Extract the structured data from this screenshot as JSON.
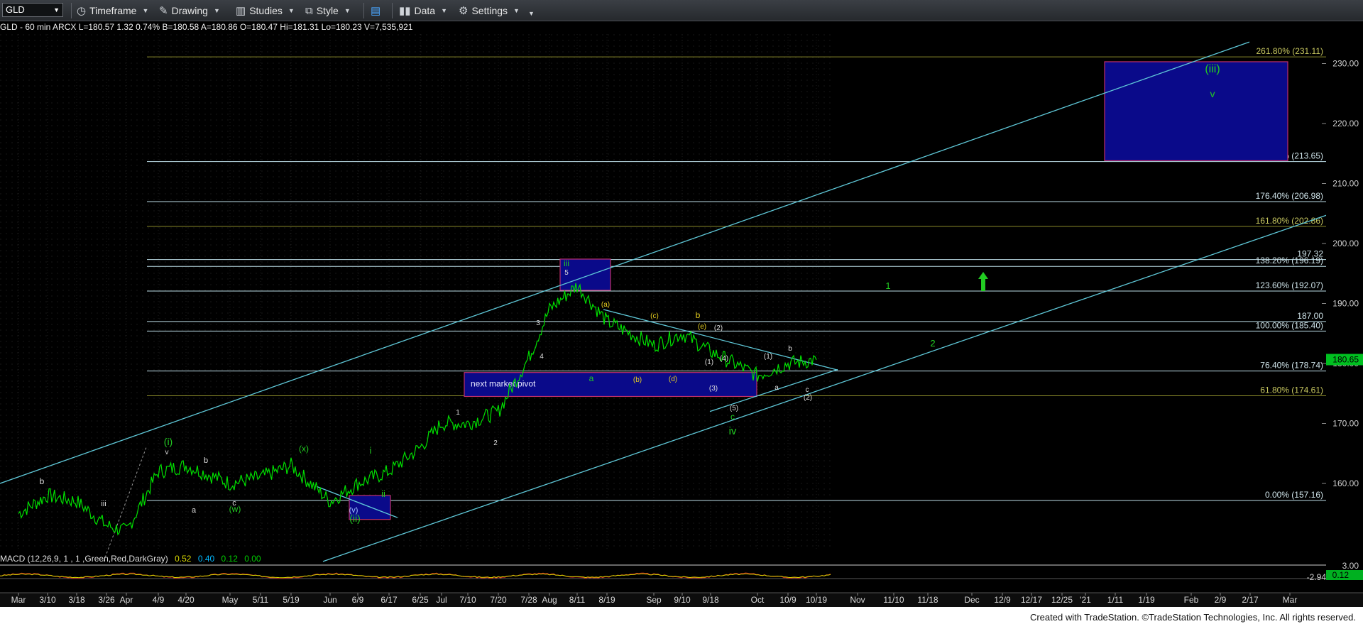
{
  "toolbar": {
    "symbol": "GLD",
    "timeframe": "Timeframe",
    "drawing": "Drawing",
    "studies": "Studies",
    "style": "Style",
    "data": "Data",
    "settings": "Settings"
  },
  "infobar": "GLD - 60 min  ARCX  L=180.57  1.32  0.74%  B=180.58  A=180.86  O=180.47  Hi=181.31  Lo=180.23  V=7,535,921",
  "macd": {
    "label": "MACD (12,26,9, 1 , 1 ,Green,Red,DarkGray)",
    "v1": "0.52",
    "v2": "0.40",
    "v3": "0.12",
    "v4": "0.00",
    "axis_top": "3.00",
    "axis_mid": "-2.94",
    "axis_val": "0.12"
  },
  "footer": "Created with TradeStation. ©TradeStation Technologies, Inc. All rights reserved.",
  "colors": {
    "price": "#00e000",
    "trendline": "#5fc8d8",
    "fib": "#bcdce6",
    "fib_olive": "#8a8a2a",
    "box_fill": "#0a0a8a",
    "box_edge": "#c0306a",
    "wave_green": "#22cc22",
    "wave_white": "#dddddd",
    "wave_yellow": "#e8d020"
  },
  "chart_data": {
    "type": "line",
    "title": "GLD - 60 min",
    "ylim": [
      150,
      235
    ],
    "y_ticks": [
      "230.00",
      "220.00",
      "210.00",
      "200.00",
      "190.00",
      "180.00",
      "170.00",
      "160.00"
    ],
    "last_price": "180.65",
    "x_ticks": [
      "Mar",
      "3/10",
      "3/18",
      "3/26",
      "Apr",
      "4/9",
      "4/20",
      "May",
      "5/11",
      "5/19",
      "Jun",
      "6/9",
      "6/17",
      "6/25",
      "Jul",
      "7/10",
      "7/20",
      "7/28",
      "Aug",
      "8/11",
      "8/19",
      "Sep",
      "9/10",
      "9/18",
      "Oct",
      "10/9",
      "10/19",
      "Nov",
      "11/10",
      "11/18",
      "Dec",
      "12/9",
      "12/17",
      "12/25",
      "'21",
      "1/11",
      "1/19",
      "Feb",
      "2/9",
      "2/17",
      "Mar"
    ],
    "series": [
      {
        "name": "GLD",
        "x": [
          "Mar",
          "3/10",
          "3/18",
          "3/26",
          "Apr",
          "4/9",
          "4/20",
          "May",
          "5/11",
          "5/19",
          "Jun",
          "6/9",
          "6/17",
          "6/25",
          "Jul",
          "7/10",
          "7/20",
          "7/28",
          "Aug",
          "8/11",
          "8/19",
          "Sep",
          "9/10",
          "9/18",
          "Oct",
          "10/9",
          "10/19"
        ],
        "values": [
          155,
          158,
          157,
          153,
          152,
          162,
          163,
          160,
          161,
          163,
          157,
          160,
          162,
          166,
          170,
          170,
          172,
          181,
          189,
          193,
          187,
          183,
          185,
          182,
          178,
          180,
          180.6
        ]
      }
    ],
    "fib_levels": [
      {
        "label": "261.80% (231.11)",
        "value": 231.11
      },
      {
        "label": "200.00% (213.65)",
        "value": 213.65
      },
      {
        "label": "176.40% (206.98)",
        "value": 206.98
      },
      {
        "label": "161.80% (202.86)",
        "value": 202.86
      },
      {
        "label": "197.32",
        "value": 197.32
      },
      {
        "label": "138.20% (196.19)",
        "value": 196.19
      },
      {
        "label": "123.60% (192.07)",
        "value": 192.07
      },
      {
        "label": "187.00",
        "value": 187.0
      },
      {
        "label": "100.00% (185.40)",
        "value": 185.4
      },
      {
        "label": "76.40% (178.74)",
        "value": 178.74
      },
      {
        "label": "61.80% (174.61)",
        "value": 174.61
      },
      {
        "label": "0.00% (157.16)",
        "value": 157.16
      }
    ],
    "annotations": {
      "pivot_label": "next market pivot",
      "target_iii": "(iii)",
      "target_v": "v",
      "wave_iii": "iii",
      "wave_5": "5",
      "wave_a_green": "a",
      "wave_b_yellow": "b",
      "wave_c_green": "c",
      "wave_iv": "iv",
      "wave_i_paren": "(i)",
      "wave_ii_paren": "(ii)",
      "wave_i": "i",
      "wave_ii": "ii",
      "wave_w": "(w)",
      "wave_x": "(x)",
      "wave_v_paren": "(v)",
      "wave_a_par": "(a)",
      "wave_b_par": "(b)",
      "wave_c_par": "(c)",
      "wave_d_par": "(d)",
      "wave_e_par": "(e)",
      "wave_1_par": "(1)",
      "wave_2_par": "(2)",
      "wave_3_par": "(3)",
      "wave_4_par": "(4)",
      "wave_5_par": "(5)",
      "proj_1": "1",
      "proj_2": "2",
      "w_b": "b",
      "w_a": "a",
      "w_c": "c",
      "w_v": "v",
      "w_iii_small": "iii",
      "w_1": "1",
      "w_2": "2",
      "w_3": "3",
      "w_4": "4"
    }
  }
}
